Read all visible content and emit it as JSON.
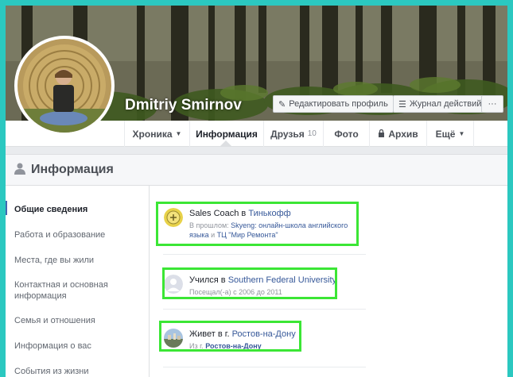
{
  "profile": {
    "name": "Dmitriy Smirnov",
    "edit_label": "Редактировать профиль",
    "log_label": "Журнал действий",
    "more_label": "···"
  },
  "tabs": [
    {
      "label": "Хроника",
      "has_caret": true
    },
    {
      "label": "Информация",
      "active": true
    },
    {
      "label": "Друзья",
      "count": "10"
    },
    {
      "label": "Фото"
    },
    {
      "label": "Архив",
      "has_lock": true
    },
    {
      "label": "Ещё",
      "has_caret": true
    }
  ],
  "section": {
    "title": "Информация"
  },
  "sidebar": {
    "items": [
      {
        "label": "Общие сведения",
        "active": true
      },
      {
        "label": "Работа и образование"
      },
      {
        "label": "Места, где вы жили"
      },
      {
        "label": "Контактная и основная информация"
      },
      {
        "label": "Семья и отношения"
      },
      {
        "label": "Информация о вас"
      },
      {
        "label": "События из жизни"
      }
    ]
  },
  "entries": {
    "work": {
      "prefix": "Sales Coach в ",
      "company": "Тинькофф",
      "past_prefix": "В прошлом: ",
      "past_company_1": "Skyeng: онлайн-школа английского языка",
      "past_joiner": " и ",
      "past_company_2": "ТЦ \"Мир Ремонта\""
    },
    "education": {
      "prefix": "Учился в ",
      "school": "Southern Federal University",
      "years": "Посещал(-а) с 2006 до 2011"
    },
    "living": {
      "prefix": "Живет в г. ",
      "city": "Ростов-на-Дону",
      "from_prefix": "Из г. ",
      "from_city": "Ростов-на-Дону"
    }
  },
  "colors": {
    "highlight": "#3be635",
    "link": "#365899",
    "border_teal": "#2bc8c0"
  }
}
